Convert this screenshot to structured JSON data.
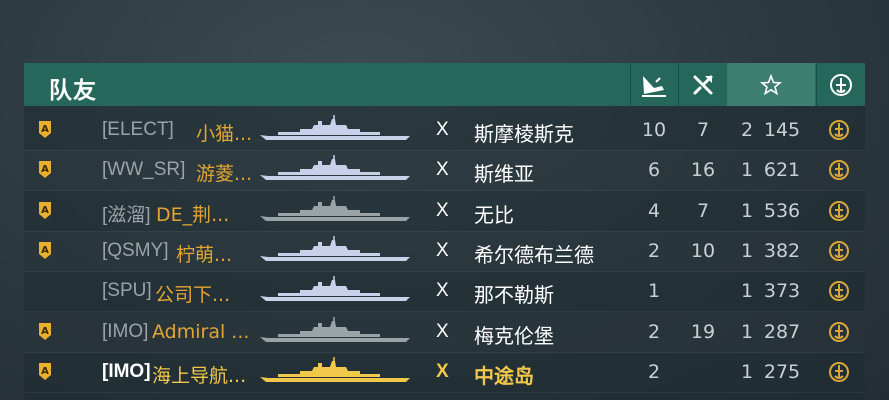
{
  "header": {
    "title": "队友",
    "col_icons": [
      "kills-icon",
      "damage-icon",
      "experience-star-icon",
      "rank-emblem-icon"
    ]
  },
  "colors": {
    "header_bg": "#25685b",
    "highlight_col": "#3f7f72",
    "name_orange": "#e3a531",
    "ship_white": "#c8d0ea",
    "ship_gray": "#9aa3a6",
    "ship_gold": "#f2c84a"
  },
  "rows": [
    {
      "badge": "A",
      "clan": "[ELECT]",
      "name": "小猫...",
      "ship_color": "white",
      "x": "X",
      "ship_name": "斯摩棱斯克",
      "c1": "10",
      "c2": "7",
      "c3": "2",
      "c4": "145"
    },
    {
      "badge": "A",
      "clan": "[WW_SR]",
      "name": "游菱...",
      "ship_color": "white",
      "x": "X",
      "ship_name": "斯维亚",
      "c1": "6",
      "c2": "16",
      "c3": "1",
      "c4": "621"
    },
    {
      "badge": "A",
      "clan": "[滋溜]",
      "name": "DE_荆...",
      "ship_color": "gray",
      "x": "X",
      "ship_name": "无比",
      "c1": "4",
      "c2": "7",
      "c3": "1",
      "c4": "536"
    },
    {
      "badge": "A",
      "clan": "[QSMY]",
      "name": "柠萌...",
      "ship_color": "white",
      "x": "X",
      "ship_name": "希尔德布兰德",
      "c1": "2",
      "c2": "10",
      "c3": "1",
      "c4": "382"
    },
    {
      "badge": "",
      "clan": "[SPU]",
      "name": "公司下...",
      "ship_color": "white",
      "x": "X",
      "ship_name": "那不勒斯",
      "c1": "1",
      "c2": "",
      "c3": "1",
      "c4": "373"
    },
    {
      "badge": "A",
      "clan": "[IMO]",
      "name": "Admiral ...",
      "ship_color": "gray",
      "x": "X",
      "ship_name": "梅克伦堡",
      "c1": "2",
      "c2": "19",
      "c3": "1",
      "c4": "287"
    },
    {
      "badge": "A",
      "clan": "[IMO]",
      "name": "海上导航...",
      "ship_color": "gold",
      "x": "X",
      "ship_name": "中途岛",
      "c1": "2",
      "c2": "",
      "c3": "1",
      "c4": "275"
    }
  ]
}
